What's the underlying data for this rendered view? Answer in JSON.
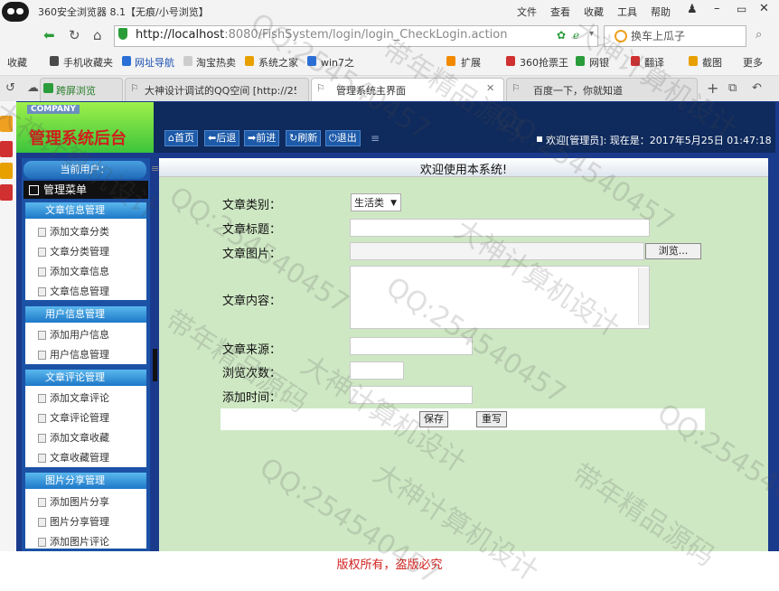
{
  "browser": {
    "window_title": "360安全浏览器 8.1【无痕/小号浏览】",
    "menu": [
      "文件",
      "查看",
      "收藏",
      "工具",
      "帮助"
    ],
    "url_host": "http://localhost",
    "url_rest": ":8080/FishSystem/login/login_CheckLogin.action",
    "search_text": "换车上瓜子",
    "bookmarks": [
      "收藏",
      "手机收藏夹",
      "网址导航",
      "淘宝热卖",
      "系统之家",
      "win7之",
      "扩展",
      "360抢票王",
      "网银",
      "翻译",
      "截图",
      "更多"
    ],
    "tabs": [
      {
        "label": "跨屏浏览"
      },
      {
        "label": "大神设计调试的QQ空间 [http://25"
      },
      {
        "label": "管理系统主界面"
      },
      {
        "label": "百度一下，你就知道"
      }
    ]
  },
  "app": {
    "company": "COMPANY",
    "title": "管理系统后台",
    "nav": [
      "首页",
      "后退",
      "前进",
      "刷新",
      "退出"
    ],
    "welcome": "欢迎[管理员]:  现在是：2017年5月25日 01:47:18",
    "current_user": "当前用户：",
    "menu_title": "管理菜单",
    "groups": [
      {
        "title": "文章信息管理",
        "items": [
          "添加文章分类",
          "文章分类管理",
          "添加文章信息",
          "文章信息管理"
        ]
      },
      {
        "title": "用户信息管理",
        "items": [
          "添加用户信息",
          "用户信息管理"
        ]
      },
      {
        "title": "文章评论管理",
        "items": [
          "添加文章评论",
          "文章评论管理",
          "添加文章收藏",
          "文章收藏管理"
        ]
      },
      {
        "title": "图片分享管理",
        "items": [
          "添加图片分享",
          "图片分享管理",
          "添加图片评论"
        ]
      }
    ],
    "main_header": "欢迎使用本系统!",
    "form": {
      "category_label": "文章类别：",
      "category_value": "生活类",
      "title_label": "文章标题：",
      "image_label": "文章图片：",
      "browse_button": "浏览...",
      "content_label": "文章内容：",
      "source_label": "文章来源：",
      "views_label": "浏览次数：",
      "time_label": "添加时间：",
      "save_button": "保存",
      "reset_button": "重写"
    },
    "copyright": "版权所有，盗版必究"
  },
  "watermark": [
    "QQ:254540457",
    "大神计算机设计",
    "带年精品源码"
  ]
}
